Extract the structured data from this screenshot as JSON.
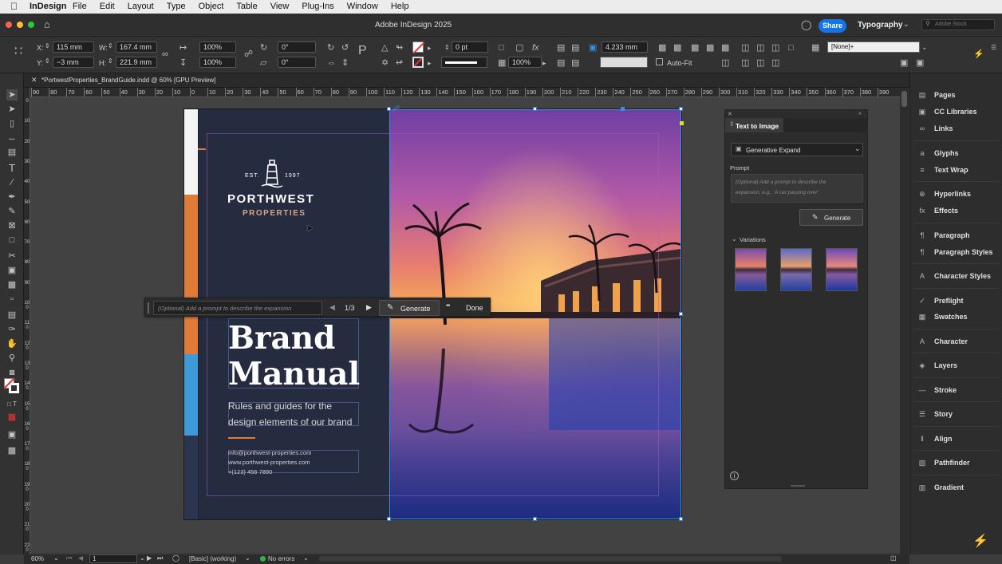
{
  "menubar": {
    "app": "InDesign",
    "items": [
      "File",
      "Edit",
      "Layout",
      "Type",
      "Object",
      "Table",
      "View",
      "Plug-Ins",
      "Window",
      "Help"
    ]
  },
  "titlebar": {
    "title": "Adobe InDesign 2025",
    "share": "Share",
    "workspace": "Typography",
    "stock_placeholder": "Adobe Stock"
  },
  "control": {
    "x_label": "X:",
    "x_value": "115 mm",
    "y_label": "Y:",
    "y_value": "−3 mm",
    "w_label": "W:",
    "w_value": "167.4 mm",
    "h_label": "H:",
    "h_value": "221.9 mm",
    "scale_x": "100%",
    "scale_y": "100%",
    "rotate": "0°",
    "shear": "0°",
    "stroke_weight": "0 pt",
    "opacity": "100%",
    "fitting_value": "4.233 mm",
    "autofit": "Auto-Fit",
    "object_style": "[None]+"
  },
  "document_tab": "*PortwestProperties_BrandGuide.indd @ 60% [GPU Preview]",
  "ruler": {
    "h_ticks": [
      "90",
      "80",
      "70",
      "60",
      "50",
      "40",
      "30",
      "20",
      "10",
      "0",
      "10",
      "20",
      "30",
      "40",
      "50",
      "60",
      "70",
      "80",
      "90",
      "100",
      "110",
      "120",
      "130",
      "140",
      "150",
      "160",
      "170",
      "180",
      "190",
      "200",
      "210",
      "220",
      "230",
      "240",
      "250",
      "260",
      "270",
      "280",
      "290",
      "300",
      "310",
      "320",
      "330",
      "340",
      "350",
      "360",
      "370",
      "380",
      "390"
    ],
    "v_ticks": [
      "0",
      "1 0",
      "2 0",
      "3 0",
      "4 0",
      "5 0",
      "6 0",
      "7 0",
      "8 0",
      "9 0",
      "1 0 0",
      "1 1 0",
      "1 2 0",
      "1 3 0",
      "1 4 0",
      "1 5 0",
      "1 6 0",
      "1 7 0",
      "1 8 0",
      "1 9 0",
      "2 0 0",
      "2 1 0",
      "2 2 0"
    ]
  },
  "doc": {
    "est": "EST.",
    "year": "1997",
    "brand_name": "PORTHWEST",
    "brand_sub": "PROPERTIES",
    "title_line1": "Brand",
    "title_line2": "Manual",
    "subtitle_line1": "Rules and guides for the",
    "subtitle_line2": "design elements of our brand",
    "contact_email": "info@porthwest-properties.com",
    "contact_web": "www.porthwest-properties.com",
    "contact_phone": "+(123) 456 7890"
  },
  "contextbar": {
    "placeholder": "(Optional) Add a prompt to describe the expansion",
    "counter": "1/3",
    "generate": "Generate",
    "more": "•••",
    "done": "Done"
  },
  "t2i": {
    "title": "Text to Image",
    "mode": "Generative Expand",
    "prompt_label": "Prompt",
    "prompt_placeholder_1": "(Optional) Add a prompt to describe the",
    "prompt_placeholder_2": "expansion, e.g., 'A car passing over'",
    "generate": "Generate",
    "variations_label": "Variations"
  },
  "panels": [
    {
      "icon": "pages-icon",
      "glyph": "▤",
      "label": "Pages"
    },
    {
      "icon": "cc-libraries-icon",
      "glyph": "▣",
      "label": "CC Libraries"
    },
    {
      "icon": "links-icon",
      "glyph": "∞",
      "label": "Links"
    },
    {
      "icon": "glyphs-icon",
      "glyph": "a",
      "label": "Glyphs"
    },
    {
      "icon": "text-wrap-icon",
      "glyph": "≡",
      "label": "Text Wrap"
    },
    {
      "icon": "hyperlinks-icon",
      "glyph": "⊕",
      "label": "Hyperlinks"
    },
    {
      "icon": "effects-icon",
      "glyph": "fx",
      "label": "Effects"
    },
    {
      "icon": "paragraph-icon",
      "glyph": "¶",
      "label": "Paragraph"
    },
    {
      "icon": "paragraph-styles-icon",
      "glyph": "¶",
      "label": "Paragraph Styles"
    },
    {
      "icon": "character-styles-icon",
      "glyph": "A",
      "label": "Character Styles"
    },
    {
      "icon": "preflight-icon",
      "glyph": "✓",
      "label": "Preflight"
    },
    {
      "icon": "swatches-icon",
      "glyph": "▦",
      "label": "Swatches"
    },
    {
      "icon": "character-icon",
      "glyph": "A",
      "label": "Character"
    },
    {
      "icon": "layers-icon",
      "glyph": "◈",
      "label": "Layers"
    },
    {
      "icon": "stroke-icon",
      "glyph": "—",
      "label": "Stroke"
    },
    {
      "icon": "story-icon",
      "glyph": "☰",
      "label": "Story"
    },
    {
      "icon": "align-icon",
      "glyph": "‖",
      "label": "Align"
    },
    {
      "icon": "pathfinder-icon",
      "glyph": "▧",
      "label": "Pathfinder"
    },
    {
      "icon": "gradient-icon",
      "glyph": "▥",
      "label": "Gradient"
    }
  ],
  "status": {
    "zoom": "60%",
    "page": "1",
    "profile": "[Basic] (working)",
    "errors": "No errors"
  },
  "colors": {
    "page_bg": "#252c3f",
    "accent_orange": "#e07a37",
    "accent_blue": "#3d9ad6",
    "share_blue": "#1473e6",
    "brand_sub": "#d9a58a"
  }
}
